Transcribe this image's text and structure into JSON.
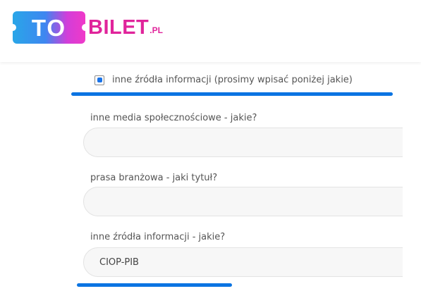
{
  "logo": {
    "badge_text": "TO",
    "brand_text": "BILET",
    "suffix_text": ".PL",
    "colors": {
      "gradient_start": "#29a6e8",
      "gradient_end": "#f039c8",
      "brand": "#e0249b"
    }
  },
  "form": {
    "checkbox_option": {
      "label": "inne źródła informacji (prosimy wpisać poniżej jakie)",
      "checked": true
    },
    "fields": [
      {
        "label": "inne media społecznościowe - jakie?",
        "value": "",
        "placeholder": ""
      },
      {
        "label": "prasa branżowa - jaki tytuł?",
        "value": "",
        "placeholder": ""
      },
      {
        "label": "inne źródła informacji - jakie?",
        "value": "CIOP-PIB",
        "placeholder": ""
      }
    ]
  },
  "colors": {
    "accent": "#0b74e2",
    "checkbox_fill": "#1a73e8",
    "label_text": "#555555"
  }
}
